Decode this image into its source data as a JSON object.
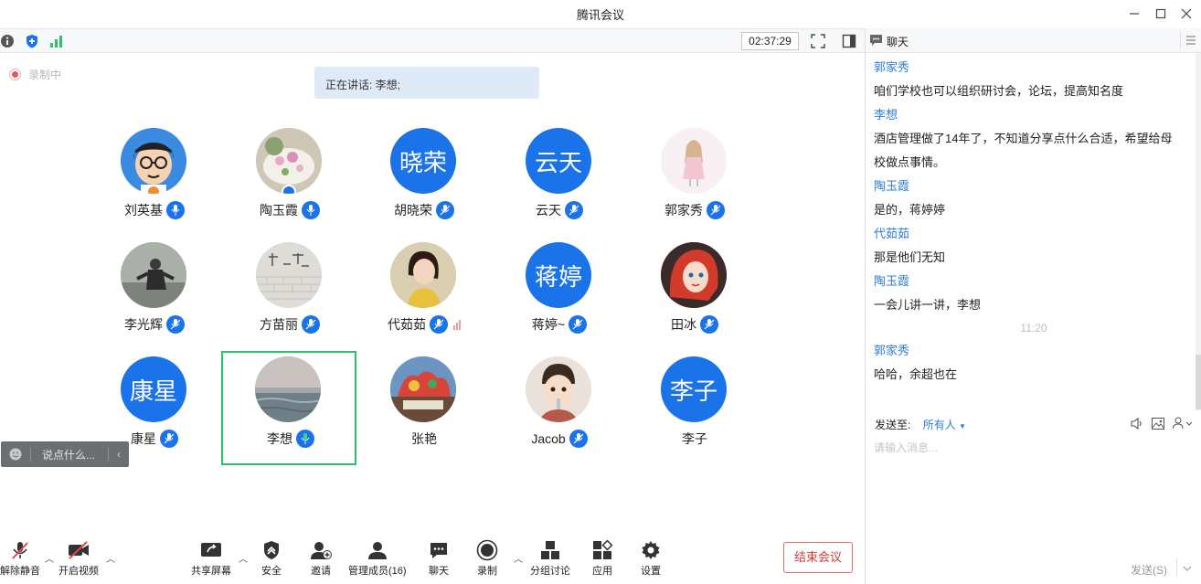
{
  "window": {
    "title": "腾讯会议"
  },
  "toolbar": {
    "timer": "02:37:29"
  },
  "recording": {
    "label": "录制中"
  },
  "speaking": {
    "text": "正在讲话: 李想;"
  },
  "participants": [
    {
      "name": "刘英基",
      "avatar_text": "",
      "avatar_kind": "cartoon"
    },
    {
      "name": "陶玉霞",
      "avatar_text": "",
      "avatar_kind": "photo-flowers"
    },
    {
      "name": "胡晓荣",
      "avatar_text": "晓荣",
      "avatar_kind": "text"
    },
    {
      "name": "云天",
      "avatar_text": "云天",
      "avatar_kind": "text"
    },
    {
      "name": "郭家秀",
      "avatar_text": "",
      "avatar_kind": "photo-girl"
    },
    {
      "name": "李光辉",
      "avatar_text": "",
      "avatar_kind": "photo-man"
    },
    {
      "name": "方苗丽",
      "avatar_text": "",
      "avatar_kind": "photo-wall"
    },
    {
      "name": "代茹茹",
      "avatar_text": "",
      "avatar_kind": "photo-woman"
    },
    {
      "name": "蒋婷~",
      "avatar_text": "蒋婷",
      "avatar_kind": "text"
    },
    {
      "name": "田冰",
      "avatar_text": "",
      "avatar_kind": "photo-mermaid"
    },
    {
      "name": "康星",
      "avatar_text": "康星",
      "avatar_kind": "text"
    },
    {
      "name": "李想",
      "avatar_text": "",
      "avatar_kind": "photo-sea"
    },
    {
      "name": "张艳",
      "avatar_text": "",
      "avatar_kind": "photo-graffiti"
    },
    {
      "name": "Jacob",
      "avatar_text": "",
      "avatar_kind": "photo-kid"
    },
    {
      "name": "李子",
      "avatar_text": "李子",
      "avatar_kind": "text"
    }
  ],
  "say": {
    "placeholder": "说点什么..."
  },
  "bottom": {
    "unmute": "解除静音",
    "video": "开启视频",
    "share": "共享屏幕",
    "security": "安全",
    "invite": "邀请",
    "members": "管理成员(16)",
    "chat": "聊天",
    "record": "录制",
    "breakout": "分组讨论",
    "apps": "应用",
    "settings": "设置",
    "end": "结束会议"
  },
  "chat": {
    "title": "聊天",
    "messages": [
      {
        "sender": "郭家秀",
        "lines": [
          "咱们学校也可以组织研讨会，论坛，提高知名度"
        ]
      },
      {
        "sender": "李想",
        "lines": [
          "酒店管理做了14年了，不知道分享点什么合适，希望给母",
          "校做点事情。"
        ]
      },
      {
        "sender": "陶玉霞",
        "lines": [
          "是的，蒋婷婷"
        ]
      },
      {
        "sender": "代茹茹",
        "lines": [
          "那是他们无知"
        ]
      },
      {
        "sender": "陶玉霞",
        "lines": [
          "一会儿讲一讲，李想"
        ]
      },
      {
        "sender": "郭家秀",
        "lines": [
          "哈哈，余超也在"
        ]
      }
    ],
    "time_divider": "11:20",
    "send_to_label": "发送至:",
    "send_to_target": "所有人",
    "input_placeholder": "请输入消息...",
    "send_button": "发送(S)"
  },
  "colors": {
    "accent": "#1a73e8",
    "active_border": "#2ec06c",
    "end": "#d43838",
    "sender": "#2f7dd1"
  }
}
